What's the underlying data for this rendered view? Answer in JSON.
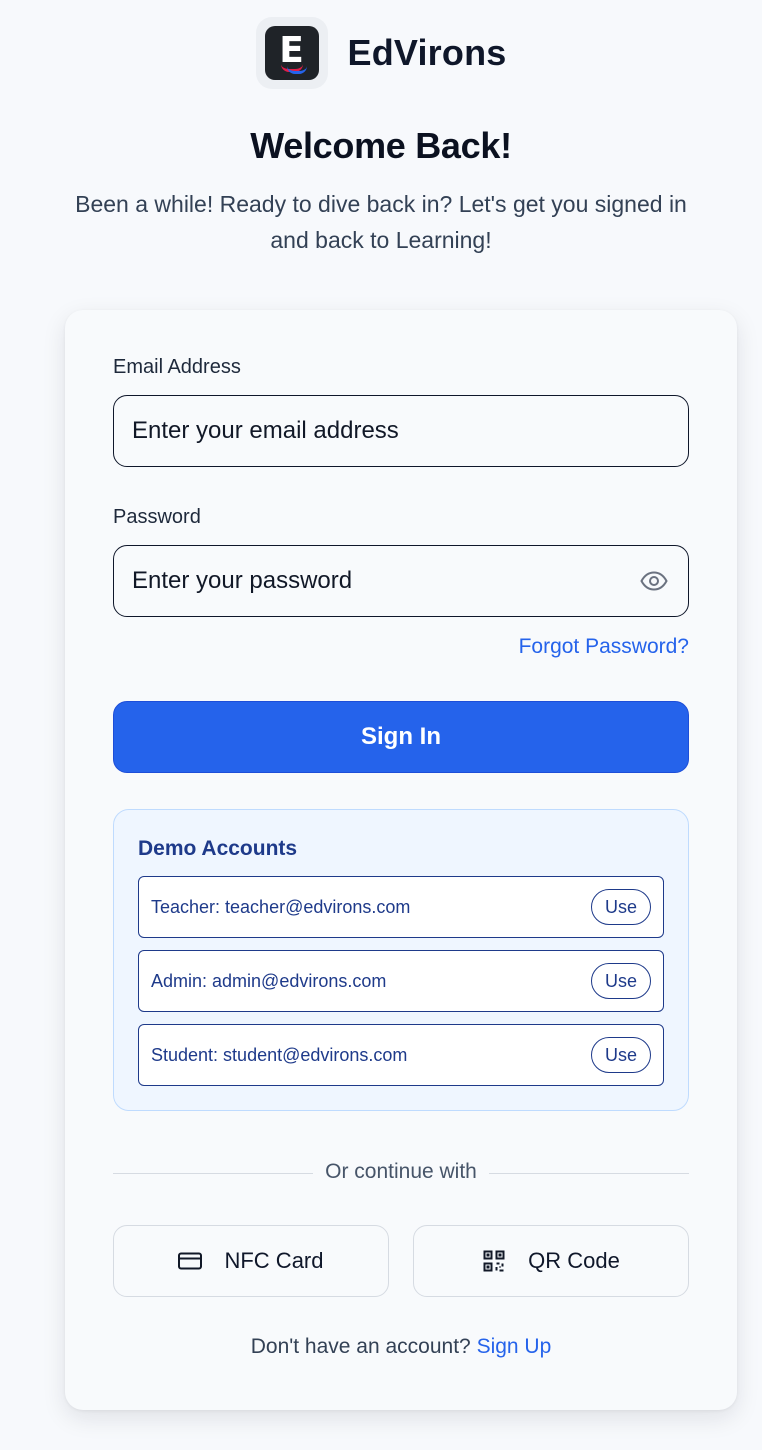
{
  "brand": {
    "name": "EdVirons",
    "logo_letter": "E"
  },
  "header": {
    "title": "Welcome Back!",
    "subtitle": "Been a while! Ready to dive back in? Let's get you signed in and back to Learning!"
  },
  "form": {
    "email_label": "Email Address",
    "email_placeholder": "Enter your email address",
    "email_value": "",
    "password_label": "Password",
    "password_placeholder": "Enter your password",
    "password_value": "",
    "forgot_label": "Forgot Password?",
    "signin_label": "Sign In"
  },
  "demo": {
    "title": "Demo Accounts",
    "accounts": [
      {
        "text": "Teacher: teacher@edvirons.com",
        "button": "Use"
      },
      {
        "text": "Admin: admin@edvirons.com",
        "button": "Use"
      },
      {
        "text": "Student: student@edvirons.com",
        "button": "Use"
      }
    ]
  },
  "alt": {
    "divider": "Or continue with",
    "nfc_label": "NFC Card",
    "nfc_icon": "credit-card-icon",
    "qr_label": "QR Code",
    "qr_icon": "qr-code-icon"
  },
  "footer": {
    "prompt": "Don't have an account?",
    "signup_label": "Sign Up"
  },
  "colors": {
    "accent": "#2563eb",
    "demo_text": "#1e3a8a",
    "background": "#f7f9fc"
  }
}
